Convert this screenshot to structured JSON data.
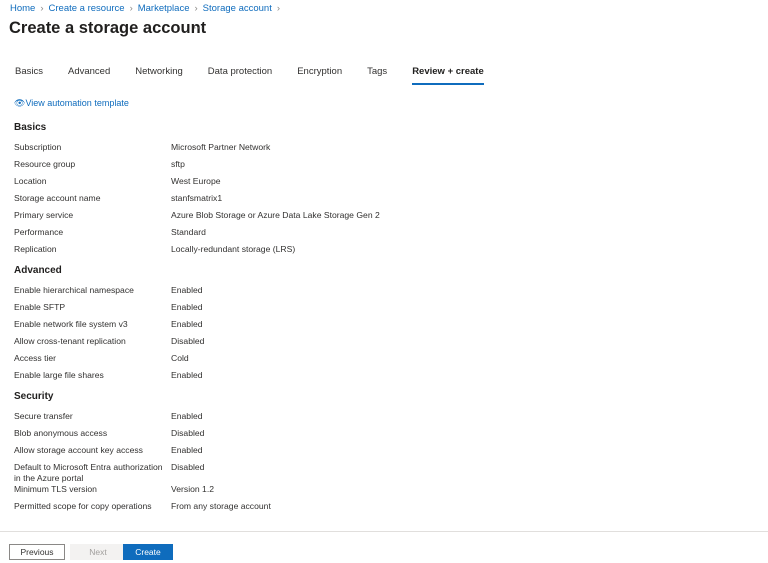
{
  "breadcrumb": [
    "Home",
    "Create a resource",
    "Marketplace",
    "Storage account"
  ],
  "title": "Create a storage account",
  "more_label": "···",
  "tabs": [
    {
      "label": "Basics",
      "active": false
    },
    {
      "label": "Advanced",
      "active": false
    },
    {
      "label": "Networking",
      "active": false
    },
    {
      "label": "Data protection",
      "active": false
    },
    {
      "label": "Encryption",
      "active": false
    },
    {
      "label": "Tags",
      "active": false
    },
    {
      "label": "Review + create",
      "active": true
    }
  ],
  "automation_link": "View automation template",
  "sections": [
    {
      "title": "Basics",
      "rows": [
        [
          "Subscription",
          "Microsoft Partner Network"
        ],
        [
          "Resource group",
          "sftp"
        ],
        [
          "Location",
          "West Europe"
        ],
        [
          "Storage account name",
          "stanfsmatrix1"
        ],
        [
          "Primary service",
          "Azure Blob Storage or Azure Data Lake Storage Gen 2"
        ],
        [
          "Performance",
          "Standard"
        ],
        [
          "Replication",
          "Locally-redundant storage (LRS)"
        ]
      ]
    },
    {
      "title": "Advanced",
      "rows": [
        [
          "Enable hierarchical namespace",
          "Enabled"
        ],
        [
          "Enable SFTP",
          "Enabled"
        ],
        [
          "Enable network file system v3",
          "Enabled"
        ],
        [
          "Allow cross-tenant replication",
          "Disabled"
        ],
        [
          "Access tier",
          "Cold"
        ],
        [
          "Enable large file shares",
          "Enabled"
        ]
      ]
    },
    {
      "title": "Security",
      "rows": [
        [
          "Secure transfer",
          "Enabled"
        ],
        [
          "Blob anonymous access",
          "Disabled"
        ],
        [
          "Allow storage account key access",
          "Enabled"
        ],
        [
          "Default to Microsoft Entra authorization in the Azure portal",
          "Disabled"
        ],
        [
          "Minimum TLS version",
          "Version 1.2"
        ],
        [
          "Permitted scope for copy operations",
          "From any storage account"
        ]
      ]
    }
  ],
  "footer": {
    "previous": "Previous",
    "next": "Next",
    "create": "Create"
  },
  "colors": {
    "accent": "#0f6cbd"
  }
}
